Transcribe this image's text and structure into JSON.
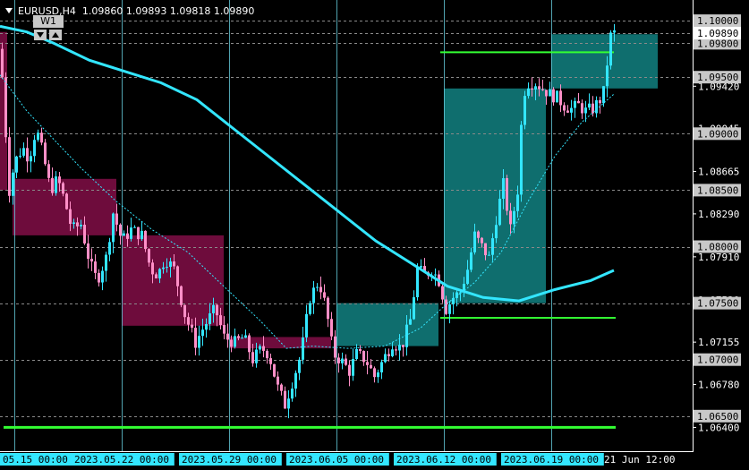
{
  "header": {
    "menu_icon": "triangle-down-icon",
    "symbol_line": "EURUSD,H4  1.09860 1.09893 1.09818 1.09890",
    "timeframe_tag": "W1",
    "nav_down_icon": "triangle-down-icon",
    "nav_up_icon": "triangle-up-icon"
  },
  "colors": {
    "background": "#000000",
    "grid": "#8a8a8a",
    "bull_candle": "#33e6ff",
    "bear_candle": "#ff8fc7",
    "moving_average": "#33e6ff",
    "signal_line": "#33e6ff",
    "level_green": "#33ff33",
    "zone_teal": "#0f6e6e",
    "zone_magenta": "#6e0c3c",
    "vertical_line": "#66ccdd",
    "axis_text": "#ffffff",
    "price_tag_bg": "#c8c8c8",
    "time_tag_bg": "#33e6ff"
  },
  "chart_data": {
    "type": "candlestick",
    "symbol": "EURUSD",
    "timeframe": "H4",
    "ohlc_last": {
      "open": 1.0986,
      "high": 1.09893,
      "low": 1.09818,
      "close": 1.0989
    },
    "ylim": [
      1.0634,
      1.1008
    ],
    "y_ticks": [
      "1.09420",
      "1.09045",
      "1.08665",
      "1.08290",
      "1.07910",
      "1.07530",
      "1.07155",
      "1.06780",
      "1.06400"
    ],
    "price_level_tags": [
      "1.10000",
      "1.09890",
      "1.09800",
      "1.09500",
      "1.09000",
      "1.08500",
      "1.08000",
      "1.07500",
      "1.07000",
      "1.06500"
    ],
    "current_price_tag": "1.09890",
    "x_labels": [
      "05.15 00:00",
      "2023.05.22 00:00",
      "2023.05.29 00:00",
      "2023.06.05 00:00",
      "2023.06.12 00:00",
      "2023.06.19 00:00",
      "21 Jun 12:00"
    ],
    "price_path": [
      [
        0,
        1.0975
      ],
      [
        6,
        1.09
      ],
      [
        10,
        1.085
      ],
      [
        16,
        1.0875
      ],
      [
        25,
        1.0888
      ],
      [
        32,
        1.0878
      ],
      [
        40,
        1.0905
      ],
      [
        48,
        1.088
      ],
      [
        56,
        1.085
      ],
      [
        64,
        1.086
      ],
      [
        72,
        1.084
      ],
      [
        80,
        1.0815
      ],
      [
        90,
        1.082
      ],
      [
        100,
        1.0785
      ],
      [
        108,
        1.077
      ],
      [
        118,
        1.079
      ],
      [
        126,
        1.083
      ],
      [
        136,
        1.0805
      ],
      [
        146,
        1.0815
      ],
      [
        158,
        1.081
      ],
      [
        168,
        1.078
      ],
      [
        176,
        1.0775
      ],
      [
        184,
        1.079
      ],
      [
        194,
        1.078
      ],
      [
        206,
        1.074
      ],
      [
        218,
        1.0715
      ],
      [
        228,
        1.073
      ],
      [
        240,
        1.0745
      ],
      [
        250,
        1.072
      ],
      [
        262,
        1.0715
      ],
      [
        272,
        1.072
      ],
      [
        282,
        1.07
      ],
      [
        292,
        1.071
      ],
      [
        300,
        1.0705
      ],
      [
        310,
        1.0675
      ],
      [
        318,
        1.066
      ],
      [
        326,
        1.068
      ],
      [
        336,
        1.0705
      ],
      [
        346,
        1.0755
      ],
      [
        356,
        1.077
      ],
      [
        364,
        1.0745
      ],
      [
        372,
        1.0705
      ],
      [
        380,
        1.07
      ],
      [
        390,
        1.069
      ],
      [
        398,
        1.0705
      ],
      [
        408,
        1.07
      ],
      [
        418,
        1.0685
      ],
      [
        428,
        1.07
      ],
      [
        438,
        1.0715
      ],
      [
        448,
        1.071
      ],
      [
        458,
        1.0735
      ],
      [
        466,
        1.078
      ],
      [
        474,
        1.0775
      ],
      [
        482,
        1.078
      ],
      [
        490,
        1.077
      ],
      [
        498,
        1.0745
      ],
      [
        506,
        1.0755
      ],
      [
        514,
        1.076
      ],
      [
        522,
        1.078
      ],
      [
        530,
        1.081
      ],
      [
        538,
        1.08
      ],
      [
        546,
        1.079
      ],
      [
        554,
        1.0825
      ],
      [
        562,
        1.0855
      ],
      [
        570,
        1.0815
      ],
      [
        578,
        1.085
      ],
      [
        584,
        1.0935
      ],
      [
        590,
        1.0945
      ],
      [
        598,
        1.0945
      ],
      [
        606,
        1.094
      ],
      [
        614,
        1.0935
      ],
      [
        622,
        1.0932
      ],
      [
        630,
        1.0925
      ],
      [
        638,
        1.0922
      ],
      [
        646,
        1.0925
      ],
      [
        654,
        1.092
      ],
      [
        662,
        1.0922
      ],
      [
        670,
        1.093
      ],
      [
        676,
        1.094
      ],
      [
        680,
        1.0985
      ],
      [
        686,
        1.0989
      ]
    ],
    "moving_average": [
      [
        0,
        1.0995
      ],
      [
        30,
        1.099
      ],
      [
        60,
        1.098
      ],
      [
        100,
        1.0965
      ],
      [
        140,
        1.0955
      ],
      [
        180,
        1.0945
      ],
      [
        220,
        1.093
      ],
      [
        260,
        1.0905
      ],
      [
        300,
        1.088
      ],
      [
        340,
        1.0855
      ],
      [
        380,
        1.083
      ],
      [
        420,
        1.0805
      ],
      [
        460,
        1.0785
      ],
      [
        500,
        1.0765
      ],
      [
        540,
        1.0755
      ],
      [
        580,
        1.0752
      ],
      [
        620,
        1.0762
      ],
      [
        660,
        1.077
      ],
      [
        686,
        1.0779
      ]
    ],
    "signal_line": [
      [
        0,
        1.0952
      ],
      [
        30,
        1.092
      ],
      [
        60,
        1.0895
      ],
      [
        90,
        1.087
      ],
      [
        130,
        1.084
      ],
      [
        170,
        1.0815
      ],
      [
        210,
        1.0795
      ],
      [
        250,
        1.0765
      ],
      [
        290,
        1.0735
      ],
      [
        320,
        1.071
      ],
      [
        350,
        1.0712
      ],
      [
        390,
        1.071
      ],
      [
        430,
        1.0712
      ],
      [
        470,
        1.0728
      ],
      [
        500,
        1.075
      ],
      [
        530,
        1.0768
      ],
      [
        560,
        1.0795
      ],
      [
        590,
        1.084
      ],
      [
        620,
        1.088
      ],
      [
        650,
        1.091
      ],
      [
        686,
        1.0935
      ]
    ],
    "zones": [
      {
        "color": "magenta",
        "x": [
          0,
          8
        ],
        "y": [
          1.085,
          1.099
        ]
      },
      {
        "color": "magenta",
        "x": [
          14,
          130
        ],
        "y": [
          1.081,
          1.086
        ]
      },
      {
        "color": "magenta",
        "x": [
          136,
          250
        ],
        "y": [
          1.073,
          1.081
        ]
      },
      {
        "color": "magenta",
        "x": [
          256,
          370
        ],
        "y": [
          1.071,
          1.072
        ]
      },
      {
        "color": "teal",
        "x": [
          376,
          490
        ],
        "y": [
          1.0712,
          1.075
        ]
      },
      {
        "color": "teal",
        "x": [
          496,
          610
        ],
        "y": [
          1.075,
          1.094
        ]
      },
      {
        "color": "teal",
        "x": [
          616,
          735
        ],
        "y": [
          1.094,
          1.0988
        ]
      }
    ],
    "horizontal_levels": [
      {
        "price": 1.0972,
        "x": [
          492,
          686
        ]
      },
      {
        "price": 1.0737,
        "x": [
          492,
          688
        ]
      },
      {
        "price": 1.064,
        "x": [
          4,
          688
        ]
      }
    ],
    "vertical_lines_x": [
      16,
      136,
      256,
      376,
      496,
      616
    ],
    "grid": true
  }
}
